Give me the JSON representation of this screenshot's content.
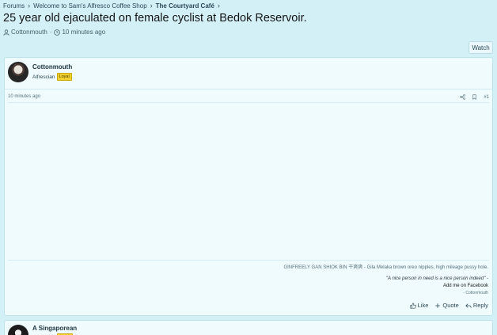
{
  "breadcrumb": {
    "items": [
      "Forums",
      "Welcome to Sam's Alfresco Coffee Shop",
      "The Courtyard Café"
    ]
  },
  "thread": {
    "title": "25 year old ejaculated on female cyclist at Bedok Reservoir.",
    "starter": "Cottonmouth",
    "started": "10 minutes ago"
  },
  "watch_label": "Watch",
  "posts": [
    {
      "author": "Cottonmouth",
      "user_title": "Alfrescian",
      "badge": "Loyal",
      "time": "10 minutes ago",
      "number": "#1",
      "signature": {
        "line1": "GINFREELY GAN SHIOK BIN 干爽爽 - Gila Melaka brown oreo nipples, high mileage pussy hole.",
        "quote": "\"A nice person in need is a nice person indeed\" -",
        "link": "Add me on Facebook",
        "credit": "- Cottonmouth"
      },
      "actions": {
        "like": "Like",
        "quote": "Quote",
        "reply": "Reply"
      }
    },
    {
      "author": "A Singaporean"
    }
  ],
  "icons": {
    "user": "user-icon",
    "clock": "clock-icon",
    "share": "share-icon",
    "bookmark": "bookmark-icon",
    "like": "thumbs-up-icon",
    "quote": "plus-icon",
    "reply": "reply-icon"
  },
  "colors": {
    "background": "#d3f0f7",
    "post_bg": "#f0fbfd",
    "badge": "#f2d12c"
  }
}
